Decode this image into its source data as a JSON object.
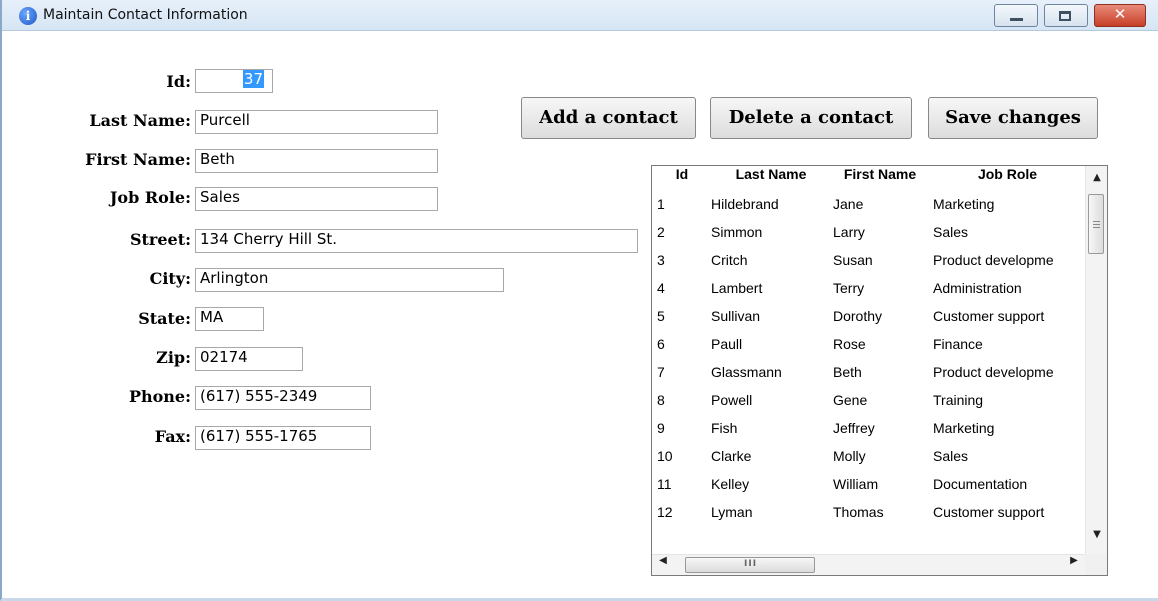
{
  "window": {
    "title": "Maintain Contact Information",
    "icon": "info-icon",
    "controls": {
      "minimize": "minimize-icon",
      "maximize": "maximize-icon",
      "close": "✕"
    }
  },
  "form": {
    "id": {
      "label": "Id:",
      "value": "37"
    },
    "last_name": {
      "label": "Last Name:",
      "value": "Purcell"
    },
    "first_name": {
      "label": "First Name:",
      "value": "Beth"
    },
    "job_role": {
      "label": "Job Role:",
      "value": "Sales"
    },
    "street": {
      "label": "Street:",
      "value": "134 Cherry Hill St."
    },
    "city": {
      "label": "City:",
      "value": "Arlington"
    },
    "state": {
      "label": "State:",
      "value": "MA"
    },
    "zip": {
      "label": "Zip:",
      "value": "02174"
    },
    "phone": {
      "label": "Phone:",
      "value": "(617) 555-2349"
    },
    "fax": {
      "label": "Fax:",
      "value": "(617) 555-1765"
    }
  },
  "buttons": {
    "add": "Add a contact",
    "delete": "Delete a contact",
    "save": "Save changes"
  },
  "table": {
    "columns": [
      "Id",
      "Last Name",
      "First Name",
      "Job Role"
    ],
    "rows": [
      [
        "1",
        "Hildebrand",
        "Jane",
        "Marketing"
      ],
      [
        "2",
        "Simmon",
        "Larry",
        "Sales"
      ],
      [
        "3",
        "Critch",
        "Susan",
        "Product developme"
      ],
      [
        "4",
        "Lambert",
        "Terry",
        "Administration"
      ],
      [
        "5",
        "Sullivan",
        "Dorothy",
        "Customer support"
      ],
      [
        "6",
        "Paull",
        "Rose",
        "Finance"
      ],
      [
        "7",
        "Glassmann",
        "Beth",
        "Product developme"
      ],
      [
        "8",
        "Powell",
        "Gene",
        "Training"
      ],
      [
        "9",
        "Fish",
        "Jeffrey",
        "Marketing"
      ],
      [
        "10",
        "Clarke",
        "Molly",
        "Sales"
      ],
      [
        "11",
        "Kelley",
        "William",
        "Documentation"
      ],
      [
        "12",
        "Lyman",
        "Thomas",
        "Customer support"
      ]
    ],
    "scroll_arrows": {
      "up": "▲",
      "down": "▼",
      "left": "◀",
      "right": "▶"
    },
    "hscroll_grip": "III"
  },
  "colors": {
    "selection": "#3399ff",
    "titlebar": "#dbe8f5"
  }
}
